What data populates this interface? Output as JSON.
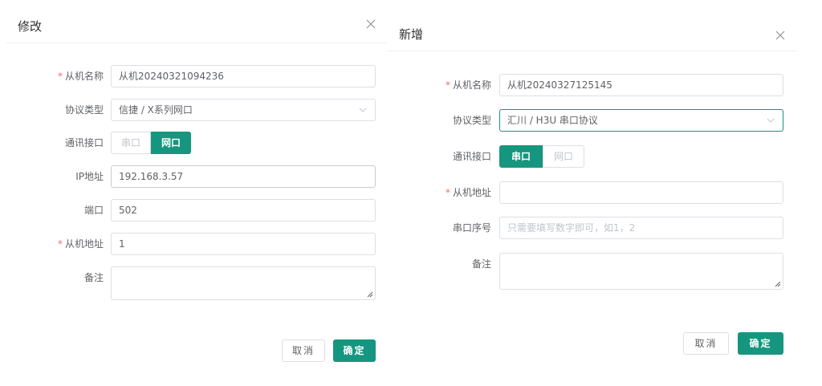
{
  "colors": {
    "accent": "#16967f",
    "required": "#f56c6c",
    "border": "#dcdfe6",
    "placeholder": "#c0c4cc"
  },
  "edit_dialog": {
    "title": "修改",
    "close_icon": "close-icon",
    "fields": {
      "slave_name": {
        "label": "从机名称",
        "required": true,
        "value": "从机20240321094236"
      },
      "protocol": {
        "label": "协议类型",
        "value": "信捷 / X系列网口"
      },
      "interface": {
        "label": "通讯接口",
        "options": [
          "串口",
          "网口"
        ],
        "selected": "网口"
      },
      "ip": {
        "label": "IP地址",
        "value": "192.168.3.57"
      },
      "port": {
        "label": "端口",
        "value": "502"
      },
      "slave_addr": {
        "label": "从机地址",
        "required": true,
        "value": "1"
      },
      "remark": {
        "label": "备注",
        "value": ""
      }
    },
    "cancel_label": "取消",
    "ok_label": "确定"
  },
  "new_dialog": {
    "title": "新增",
    "close_icon": "close-icon",
    "fields": {
      "slave_name": {
        "label": "从机名称",
        "required": true,
        "value": "从机20240327125145"
      },
      "protocol": {
        "label": "协议类型",
        "value": "汇川 / H3U 串口协议"
      },
      "interface": {
        "label": "通讯接口",
        "options": [
          "串口",
          "网口"
        ],
        "selected": "串口"
      },
      "slave_addr": {
        "label": "从机地址",
        "required": true,
        "value": ""
      },
      "serial_no": {
        "label": "串口序号",
        "value": "",
        "placeholder": "只需要填写数字即可，如1，2"
      },
      "remark": {
        "label": "备注",
        "value": ""
      }
    },
    "cancel_label": "取消",
    "ok_label": "确定"
  }
}
